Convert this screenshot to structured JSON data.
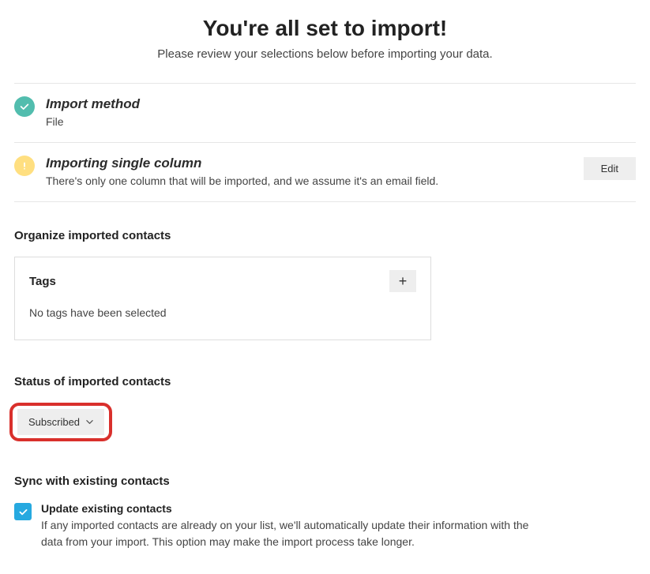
{
  "header": {
    "title": "You're all set to import!",
    "subtitle": "Please review your selections below before importing your data."
  },
  "rows": {
    "method": {
      "title": "Import method",
      "value": "File"
    },
    "single_col": {
      "title": "Importing single column",
      "desc": "There's only one column that will be imported, and we assume it's an email field.",
      "edit_label": "Edit"
    }
  },
  "organize": {
    "heading": "Organize imported contacts",
    "tags_title": "Tags",
    "tags_empty": "No tags have been selected",
    "add_symbol": "+"
  },
  "status": {
    "heading": "Status of imported contacts",
    "selected": "Subscribed"
  },
  "sync": {
    "heading": "Sync with existing contacts",
    "title": "Update existing contacts",
    "desc": "If any imported contacts are already on your list, we'll automatically update their information with the data from your import. This option may make the import process take longer."
  }
}
